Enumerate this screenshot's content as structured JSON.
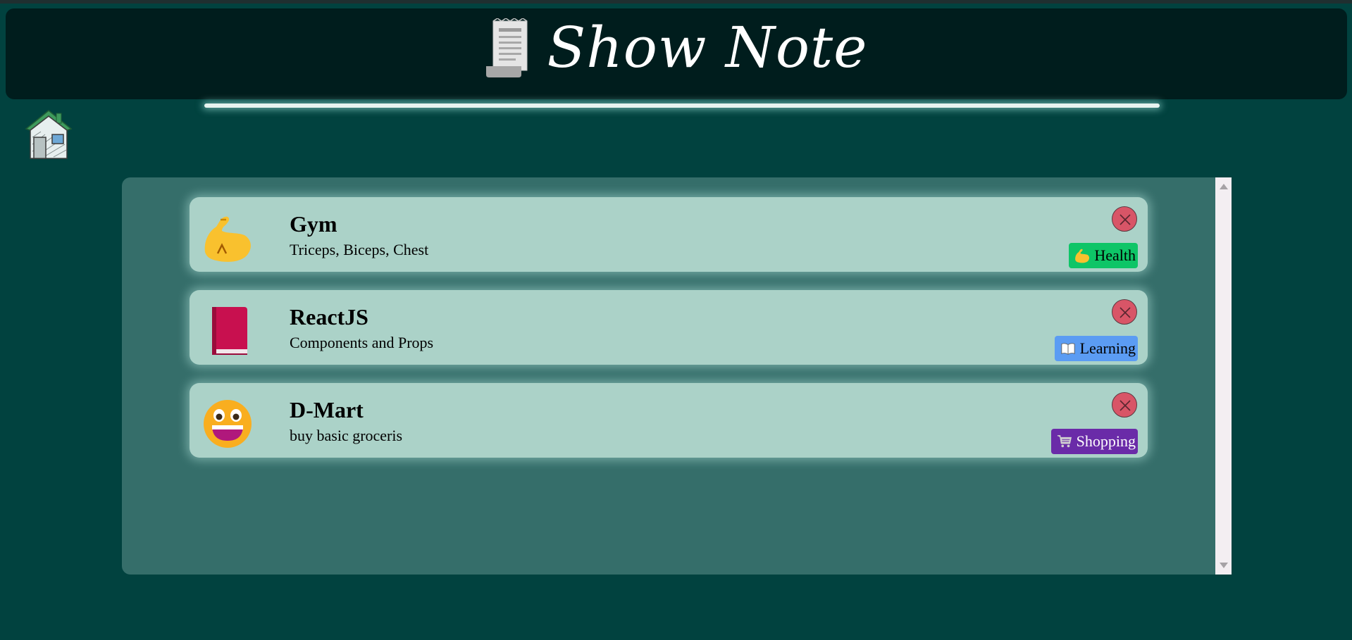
{
  "header": {
    "title": "Show Note",
    "title_icon": "receipt-icon"
  },
  "nav": {
    "home_icon": "home-icon"
  },
  "notes": [
    {
      "title": "Gym",
      "description": "Triceps, Biceps, Chest",
      "emoji": "flexed-biceps-icon",
      "tag": {
        "label": "Health",
        "icon": "flexed-biceps-icon",
        "bg": "#0ec567",
        "fg": "#000000"
      }
    },
    {
      "title": "ReactJS",
      "description": "Components and Props",
      "emoji": "red-book-icon",
      "tag": {
        "label": "Learning",
        "icon": "open-book-icon",
        "bg": "#5b9cf3",
        "fg": "#000000"
      }
    },
    {
      "title": "D-Mart",
      "description": "buy basic groceris",
      "emoji": "grinning-face-icon",
      "tag": {
        "label": "Shopping",
        "icon": "shopping-cart-icon",
        "bg": "#6a2ba8",
        "fg": "#ffffff"
      }
    }
  ],
  "colors": {
    "page_bg": "#01423f",
    "header_bg": "#001d1d",
    "panel_bg": "#356e6a",
    "card_bg": "#abd2c8",
    "delete_btn": "#d85567"
  }
}
